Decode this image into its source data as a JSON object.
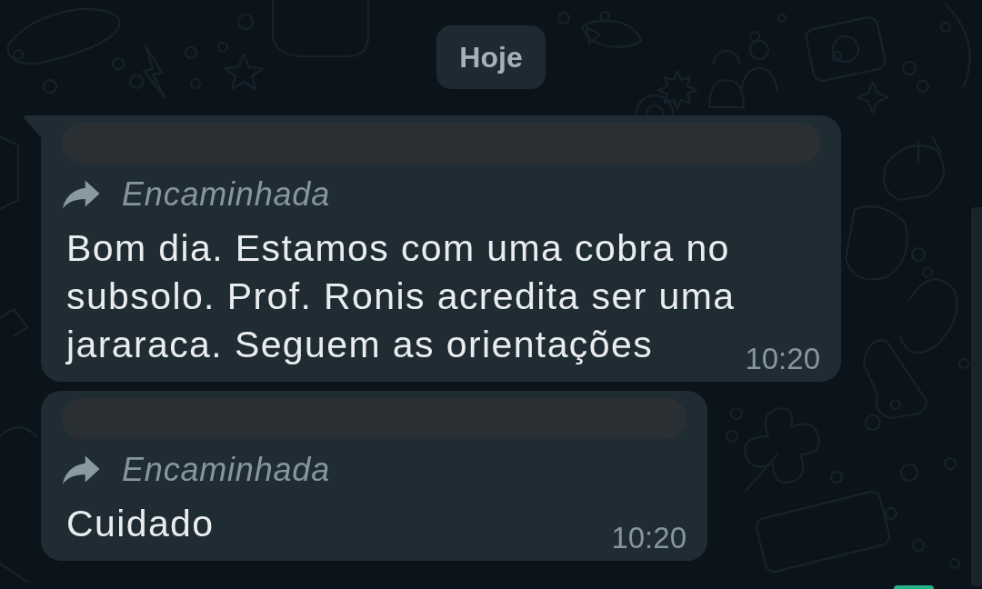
{
  "date_chip": {
    "label": "Hoje"
  },
  "messages": [
    {
      "tail": true,
      "sender_redacted": true,
      "forwarded_label": "Encaminhada",
      "text": "Bom dia. Estamos com uma cobra no subsolo. Prof. Ronis acredita ser uma jararaca. Seguem as orientações",
      "time": "10:20"
    },
    {
      "tail": false,
      "sender_redacted": true,
      "forwarded_label": "Encaminhada",
      "text": "Cuidado",
      "time": "10:20"
    }
  ]
}
